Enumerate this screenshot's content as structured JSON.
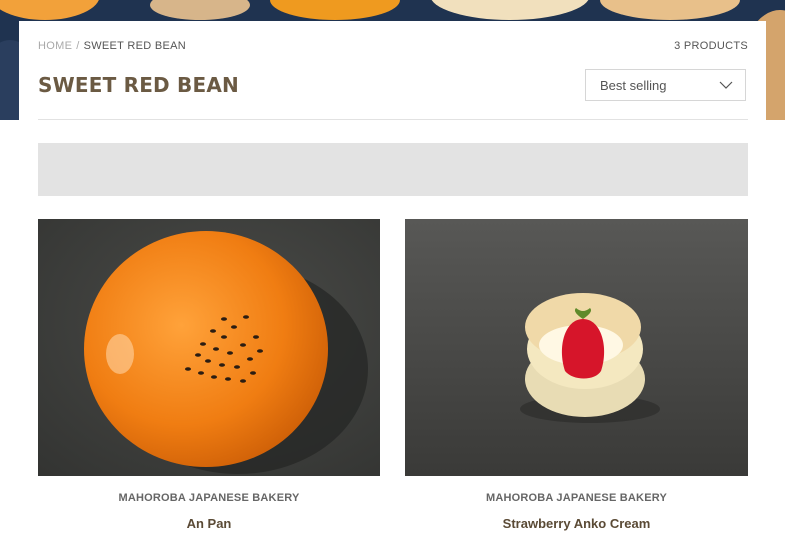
{
  "breadcrumb": {
    "home": "HOME",
    "separator": "/",
    "current": "SWEET RED BEAN"
  },
  "collection": {
    "title": "SWEET RED BEAN",
    "product_count": "3 PRODUCTS"
  },
  "sort": {
    "selected": "Best selling",
    "icon": "chevron-down-icon"
  },
  "products": [
    {
      "vendor": "MAHOROBA JAPANESE BAKERY",
      "name": "An Pan"
    },
    {
      "vendor": "MAHOROBA JAPANESE BAKERY",
      "name": "Strawberry Anko Cream"
    }
  ],
  "colors": {
    "title": "#6b5a43",
    "banner_placeholder": "#e3e3e3",
    "photo_background": "#3e3f3d",
    "an_pan": "#f07d12"
  }
}
